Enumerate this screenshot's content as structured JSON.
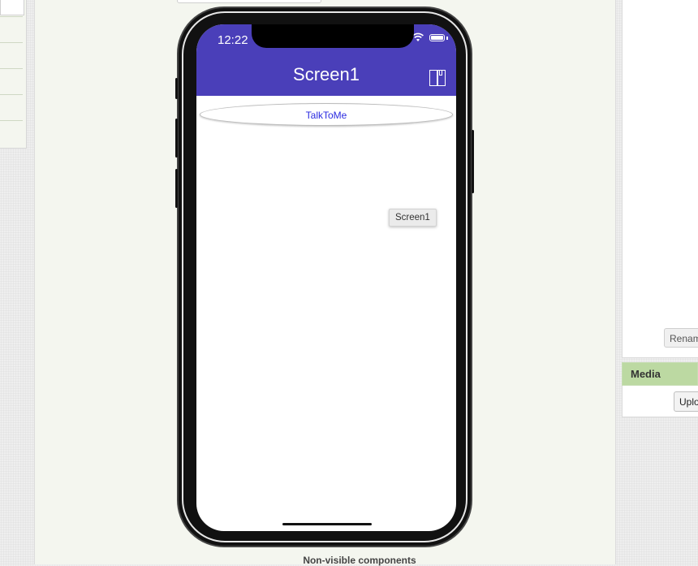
{
  "phone": {
    "status_time": "12:22",
    "app_title": "Screen1",
    "button_text": "TalkToMe",
    "screen_chip": "Screen1",
    "appbar_color": "#4a3fb9",
    "button_text_color": "#2a2ae0"
  },
  "viewer": {
    "nonvisible_label": "Non-visible components"
  },
  "right_panel": {
    "rename_label": "Renam",
    "media_header": "Media",
    "upload_label": "Uplo",
    "media_header_color": "#bcd9a2"
  },
  "icons": [
    "wifi-icon",
    "battery-icon",
    "book-icon"
  ]
}
